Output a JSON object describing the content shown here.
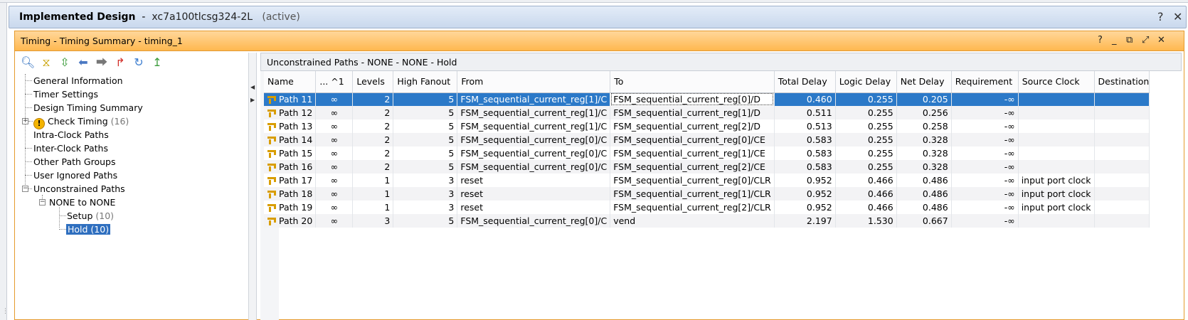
{
  "design": {
    "title": "Implemented Design",
    "part": "xc7a100tlcsg324-2L",
    "state": "(active)",
    "help": "?",
    "close": "✕"
  },
  "panel": {
    "title": "Timing - Timing Summary - timing_1",
    "controls": [
      "?",
      "_",
      "⧉",
      "⤢",
      "✕"
    ]
  },
  "toolbar_icons": [
    "search-icon",
    "collapse-all-icon",
    "expand-all-icon",
    "back-arrow-icon",
    "forward-arrow-icon",
    "report-icon",
    "refresh-icon",
    "export-icon"
  ],
  "tree": {
    "general_information": "General Information",
    "timer_settings": "Timer Settings",
    "design_timing_summary": "Design Timing Summary",
    "check_timing": "Check Timing",
    "check_timing_count": "(16)",
    "intra_clock": "Intra-Clock Paths",
    "inter_clock": "Inter-Clock Paths",
    "other_path_groups": "Other Path Groups",
    "user_ignored": "User Ignored Paths",
    "unconstrained": "Unconstrained Paths",
    "none_to_none": "NONE to NONE",
    "setup": "Setup",
    "setup_count": "(10)",
    "hold": "Hold (10)"
  },
  "right": {
    "header": "Unconstrained Paths - NONE - NONE - Hold"
  },
  "table": {
    "columns": [
      "Name",
      "... ^1",
      "Levels",
      "High Fanout",
      "From",
      "To",
      "Total Delay",
      "Logic Delay",
      "Net Delay",
      "Requirement",
      "Source Clock",
      "Destination"
    ],
    "rows": [
      {
        "name": "Path 11",
        "slack": "∞",
        "levels": "2",
        "fanout": "5",
        "from": "FSM_sequential_current_reg[1]/C",
        "to": "FSM_sequential_current_reg[0]/D",
        "total": "0.460",
        "logic": "0.255",
        "net": "0.205",
        "req": "-∞",
        "src": "",
        "dst": ""
      },
      {
        "name": "Path 12",
        "slack": "∞",
        "levels": "2",
        "fanout": "5",
        "from": "FSM_sequential_current_reg[1]/C",
        "to": "FSM_sequential_current_reg[1]/D",
        "total": "0.511",
        "logic": "0.255",
        "net": "0.256",
        "req": "-∞",
        "src": "",
        "dst": ""
      },
      {
        "name": "Path 13",
        "slack": "∞",
        "levels": "2",
        "fanout": "5",
        "from": "FSM_sequential_current_reg[1]/C",
        "to": "FSM_sequential_current_reg[2]/D",
        "total": "0.513",
        "logic": "0.255",
        "net": "0.258",
        "req": "-∞",
        "src": "",
        "dst": ""
      },
      {
        "name": "Path 14",
        "slack": "∞",
        "levels": "2",
        "fanout": "5",
        "from": "FSM_sequential_current_reg[0]/C",
        "to": "FSM_sequential_current_reg[0]/CE",
        "total": "0.583",
        "logic": "0.255",
        "net": "0.328",
        "req": "-∞",
        "src": "",
        "dst": ""
      },
      {
        "name": "Path 15",
        "slack": "∞",
        "levels": "2",
        "fanout": "5",
        "from": "FSM_sequential_current_reg[0]/C",
        "to": "FSM_sequential_current_reg[1]/CE",
        "total": "0.583",
        "logic": "0.255",
        "net": "0.328",
        "req": "-∞",
        "src": "",
        "dst": ""
      },
      {
        "name": "Path 16",
        "slack": "∞",
        "levels": "2",
        "fanout": "5",
        "from": "FSM_sequential_current_reg[0]/C",
        "to": "FSM_sequential_current_reg[2]/CE",
        "total": "0.583",
        "logic": "0.255",
        "net": "0.328",
        "req": "-∞",
        "src": "",
        "dst": ""
      },
      {
        "name": "Path 17",
        "slack": "∞",
        "levels": "1",
        "fanout": "3",
        "from": "reset",
        "to": "FSM_sequential_current_reg[0]/CLR",
        "total": "0.952",
        "logic": "0.466",
        "net": "0.486",
        "req": "-∞",
        "src": "input port clock",
        "dst": ""
      },
      {
        "name": "Path 18",
        "slack": "∞",
        "levels": "1",
        "fanout": "3",
        "from": "reset",
        "to": "FSM_sequential_current_reg[1]/CLR",
        "total": "0.952",
        "logic": "0.466",
        "net": "0.486",
        "req": "-∞",
        "src": "input port clock",
        "dst": ""
      },
      {
        "name": "Path 19",
        "slack": "∞",
        "levels": "1",
        "fanout": "3",
        "from": "reset",
        "to": "FSM_sequential_current_reg[2]/CLR",
        "total": "0.952",
        "logic": "0.466",
        "net": "0.486",
        "req": "-∞",
        "src": "input port clock",
        "dst": ""
      },
      {
        "name": "Path 20",
        "slack": "∞",
        "levels": "3",
        "fanout": "5",
        "from": "FSM_sequential_current_reg[0]/C",
        "to": "vend",
        "total": "2.197",
        "logic": "1.530",
        "net": "0.667",
        "req": "-∞",
        "src": "",
        "dst": ""
      }
    ]
  },
  "colors": {
    "panel_header": "#ffb84f",
    "selection": "#2b79c8",
    "design_bar": "#c9d8ed"
  }
}
